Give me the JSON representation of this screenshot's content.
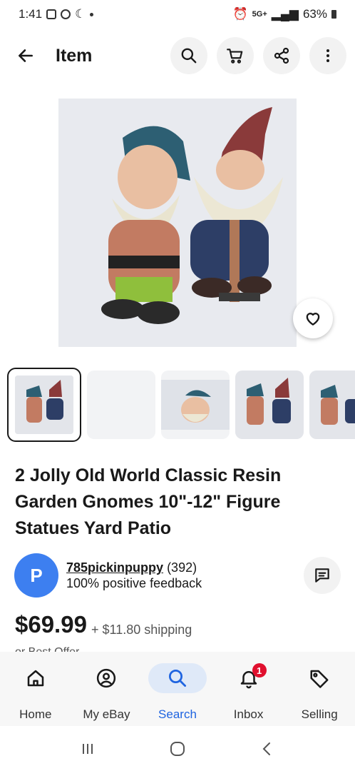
{
  "status": {
    "time": "1:41",
    "battery": "63%",
    "network": "5G+"
  },
  "header": {
    "title": "Item"
  },
  "product": {
    "title_line1": "2 Jolly Old World Classic Resin",
    "title_line2": "Garden Gnomes 10\"-12\" Figure",
    "title_line3": "Statues Yard Patio",
    "price": "$69.99",
    "shipping": "+ $11.80 shipping",
    "best_offer": "or Best Offer"
  },
  "seller": {
    "initial": "P",
    "name": "785pickinpuppy",
    "count": "(392)",
    "feedback": "100% positive feedback"
  },
  "nav": {
    "home": "Home",
    "myebay": "My eBay",
    "search": "Search",
    "inbox": "Inbox",
    "selling": "Selling",
    "inbox_badge": "1"
  },
  "colors": {
    "accent": "#1f64e0",
    "avatar": "#3d7ff0",
    "badge": "#e0102e"
  }
}
